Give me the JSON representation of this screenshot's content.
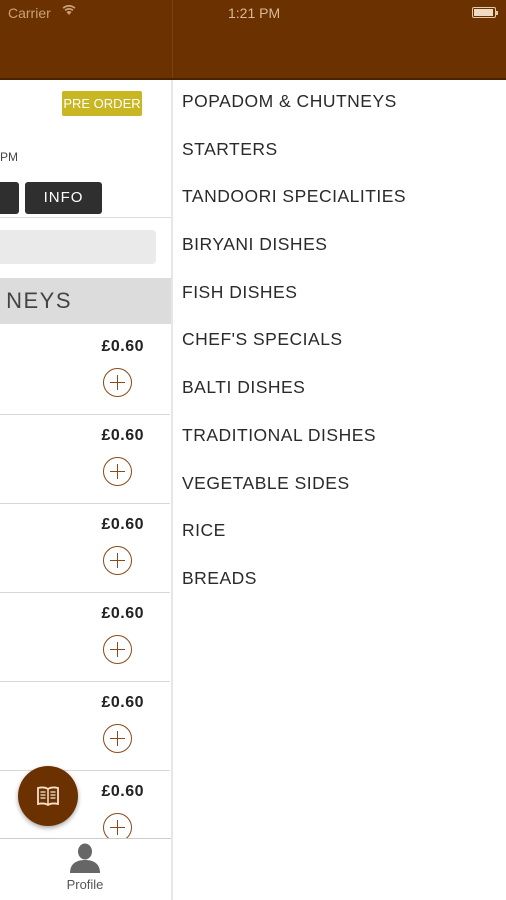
{
  "status_bar": {
    "carrier": "Carrier",
    "time": "1:21 PM"
  },
  "colors": {
    "brand_brown": "#6b3200",
    "preorder_yellow": "#c8b622",
    "dark_button": "#2f2f2f"
  },
  "left_panel": {
    "preorder_label": "PRE ORDER",
    "time_fragment": "PM",
    "info_label": "INFO",
    "category_header": "NEYS",
    "items": [
      {
        "price": "£0.60"
      },
      {
        "price": "£0.60"
      },
      {
        "price": "£0.60"
      },
      {
        "price": "£0.60"
      },
      {
        "price": "£0.60"
      },
      {
        "price": "£0.60"
      }
    ],
    "fab_icon": "menu-book-icon",
    "tab": {
      "label": "Profile",
      "icon": "person-icon"
    }
  },
  "menu": {
    "items": [
      "POPADOM & CHUTNEYS",
      "STARTERS",
      "TANDOORI SPECIALITIES",
      "BIRYANI DISHES",
      "FISH DISHES",
      "CHEF'S SPECIALS",
      "BALTI DISHES",
      "TRADITIONAL DISHES",
      "VEGETABLE SIDES",
      "RICE",
      "BREADS"
    ]
  }
}
